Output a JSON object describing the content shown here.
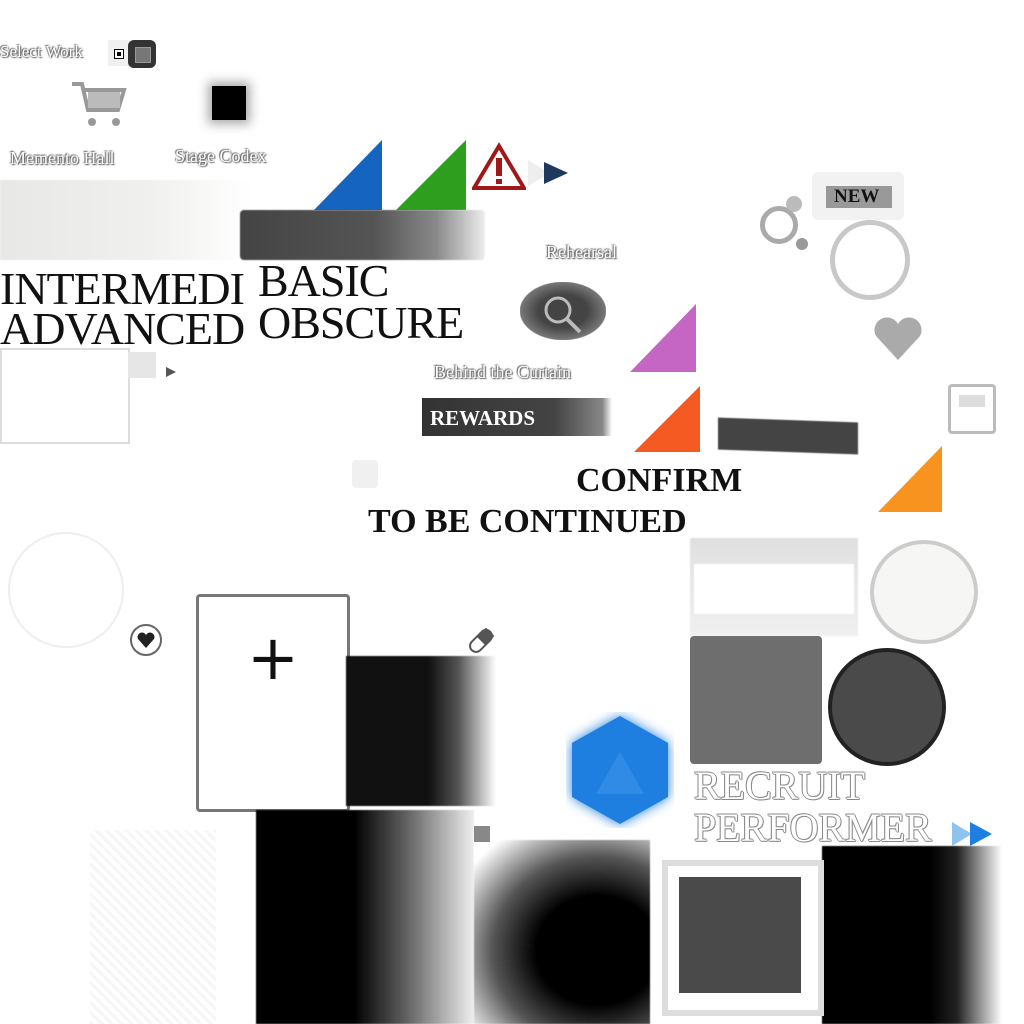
{
  "menu": {
    "select_work": "Select  Work",
    "memento_hall": "Memento Hall",
    "stage_codex": "Stage Codex",
    "rehearsal": "Rehearsal",
    "behind_the_curtain": "Behind the Curtain"
  },
  "difficulty": {
    "intermediate": "INTERMEDI",
    "advanced": "ADVANCED",
    "basic": "BASIC",
    "obscure": "OBSCURE"
  },
  "badges": {
    "new": "NEW"
  },
  "buttons": {
    "rewards": "REWARDS",
    "confirm": "CONFIRM",
    "to_be_continued": "TO BE CONTINUED",
    "add": "+"
  },
  "recruit": {
    "line1": "RECRUIT",
    "line2": "PERFORMER"
  },
  "icons": [
    "shopping-cart-icon",
    "warning-icon",
    "play-arrow-icon",
    "search-icon",
    "heart-icon",
    "pill-icon",
    "fast-forward-icon",
    "hexagon-dice-icon"
  ],
  "colors": {
    "blue": "#1565c0",
    "green": "#2e9e1f",
    "warning_red": "#a01818",
    "purple": "#c566c4",
    "orange_red": "#f55a22",
    "orange": "#f7931e",
    "hex_blue": "#1e7fe0",
    "arrow_navy": "#1d3a5c"
  }
}
